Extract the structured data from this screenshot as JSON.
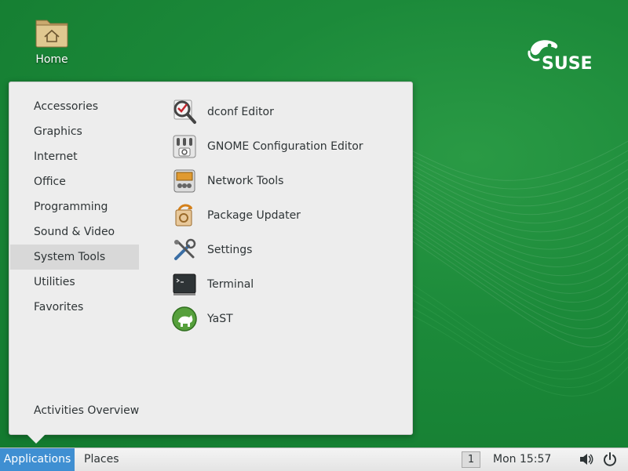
{
  "desktop": {
    "home_label": "Home",
    "logo_text": "SUSE"
  },
  "menu": {
    "categories": [
      {
        "label": "Accessories"
      },
      {
        "label": "Graphics"
      },
      {
        "label": "Internet"
      },
      {
        "label": "Office"
      },
      {
        "label": "Programming"
      },
      {
        "label": "Sound & Video"
      },
      {
        "label": "System Tools",
        "selected": true
      },
      {
        "label": "Utilities"
      },
      {
        "label": "Favorites"
      }
    ],
    "activities_overview": "Activities Overview",
    "apps": [
      {
        "label": "dconf Editor",
        "icon": "dconf-editor-icon"
      },
      {
        "label": "GNOME Configuration Editor",
        "icon": "gnome-config-editor-icon"
      },
      {
        "label": "Network Tools",
        "icon": "network-tools-icon"
      },
      {
        "label": "Package Updater",
        "icon": "package-updater-icon"
      },
      {
        "label": "Settings",
        "icon": "settings-icon"
      },
      {
        "label": "Terminal",
        "icon": "terminal-icon"
      },
      {
        "label": "YaST",
        "icon": "yast-icon"
      }
    ]
  },
  "panel": {
    "applications_label": "Applications",
    "places_label": "Places",
    "workspace_number": "1",
    "clock": "Mon 15:57",
    "volume_icon": "volume-icon",
    "power_icon": "power-icon"
  },
  "colors": {
    "desktop_green": "#1c8a3a",
    "panel_selected": "#3f8fd2",
    "menu_background": "#ededed",
    "category_selected": "#d8d8d8"
  }
}
